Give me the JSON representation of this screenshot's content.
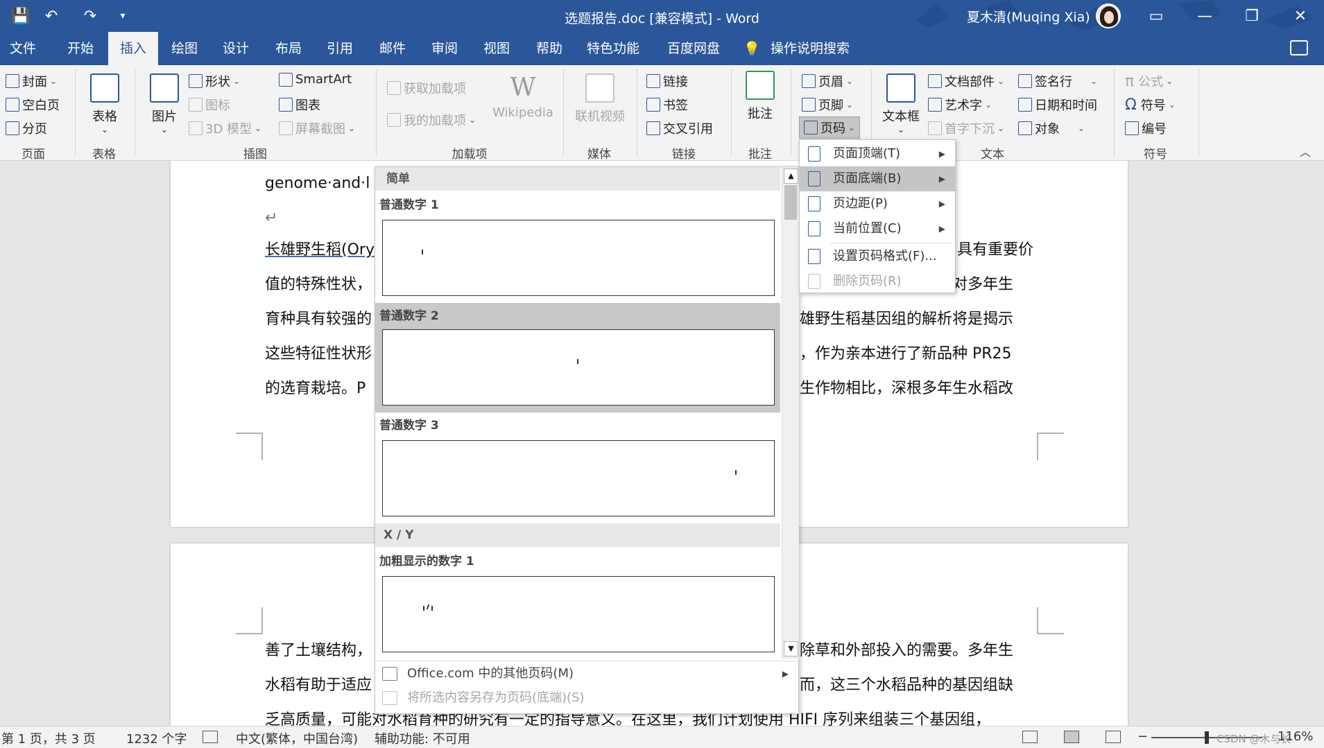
{
  "window": {
    "title": "选题报告.doc [兼容模式]  -  Word",
    "user": "夏木清(Muqing Xia)",
    "quick_access": {
      "save": "💾",
      "undo": "↶",
      "redo": "↷",
      "customize": "▾"
    },
    "controls": {
      "ribbon_display": "▭",
      "minimize": "—",
      "restore": "❐",
      "close": "✕"
    }
  },
  "tabs": [
    {
      "label": "文件"
    },
    {
      "label": "开始"
    },
    {
      "label": "插入"
    },
    {
      "label": "绘图"
    },
    {
      "label": "设计"
    },
    {
      "label": "布局"
    },
    {
      "label": "引用"
    },
    {
      "label": "邮件"
    },
    {
      "label": "审阅"
    },
    {
      "label": "视图"
    },
    {
      "label": "帮助"
    },
    {
      "label": "特色功能"
    },
    {
      "label": "百度网盘"
    },
    {
      "label": "操作说明搜索"
    }
  ],
  "active_tab": "插入",
  "ribbon": {
    "pages": {
      "cover": "封面",
      "blank": "空白页",
      "break": "分页",
      "group": "页面"
    },
    "tables": {
      "table": "表格",
      "group": "表格"
    },
    "illustrations": {
      "picture": "图片",
      "shapes": "形状",
      "icons": "图标",
      "model3d": "3D 模型",
      "smartart": "SmartArt",
      "chart": "图表",
      "screenshot": "屏幕截图",
      "group": "插图"
    },
    "addins": {
      "get": "获取加载项",
      "mine": "我的加载项",
      "wikipedia": "Wikipedia",
      "group": "加载项"
    },
    "media": {
      "video": "联机视频",
      "group": "媒体"
    },
    "links": {
      "link": "链接",
      "bookmark": "书签",
      "crossref": "交叉引用",
      "group": "链接"
    },
    "comments": {
      "comment": "批注",
      "group": "批注"
    },
    "header_footer": {
      "header": "页眉",
      "footer": "页脚",
      "page_number": "页码"
    },
    "text": {
      "textbox": "文本框",
      "quickparts": "文档部件",
      "wordart": "艺术字",
      "dropcap": "首字下沉",
      "signature": "签名行",
      "datetime": "日期和时间",
      "object": "对象",
      "group": "文本"
    },
    "symbols": {
      "equation": "公式",
      "symbol": "符号",
      "number": "编号",
      "group": "符号"
    }
  },
  "document": {
    "page1_lines": [
      "genome·and·l",
      "↵",
      "长雄野生稻(Ory",
      "值的特殊性状，",
      "育种具有较强的",
      "这些特征性状形",
      "的选育栽培。P"
    ],
    "page1_right": [
      "具有重要价",
      "稻具有较强的抗逆性，对多年生",
      "雄野生稻基因组的解析将是揭示",
      "，作为亲本进行了新品种  PR25",
      "生作物相比，深根多年生水稻改"
    ],
    "page2_left": [
      "善了土壤结构，",
      "水稻有助于适应",
      "乏高质量，可能对水稻育种的研究有一定的指导意义。在这里，我们计划使用 HIFI 序列来组装三个基因组，"
    ],
    "page2_right": [
      "除草和外部投入的需要。多年生",
      "而，这三个水稻品种的基因组缺"
    ]
  },
  "gallery": {
    "section_simple": "简单",
    "items": [
      "普通数字 1",
      "普通数字 2",
      "普通数字 3"
    ],
    "section_xy": "X / Y",
    "items_xy": [
      "加粗显示的数字 1"
    ],
    "more": "Office.com 中的其他页码(M)",
    "save_selection": "将所选内容另存为页码(底端)(S)"
  },
  "page_number_menu": [
    {
      "label": "页面顶端(T)",
      "submenu": true
    },
    {
      "label": "页面底端(B)",
      "submenu": true
    },
    {
      "label": "页边距(P)",
      "submenu": true
    },
    {
      "label": "当前位置(C)",
      "submenu": true
    },
    {
      "label": "设置页码格式(F)...",
      "submenu": false
    },
    {
      "label": "删除页码(R)",
      "submenu": false
    }
  ],
  "statusbar": {
    "page": "第 1 页，共 3 页",
    "words": "1232 个字",
    "language": "中文(繁体，中国台湾)",
    "accessibility": "辅助功能: 不可用",
    "zoom": "116%",
    "watermark": "CSDN @木与长"
  }
}
